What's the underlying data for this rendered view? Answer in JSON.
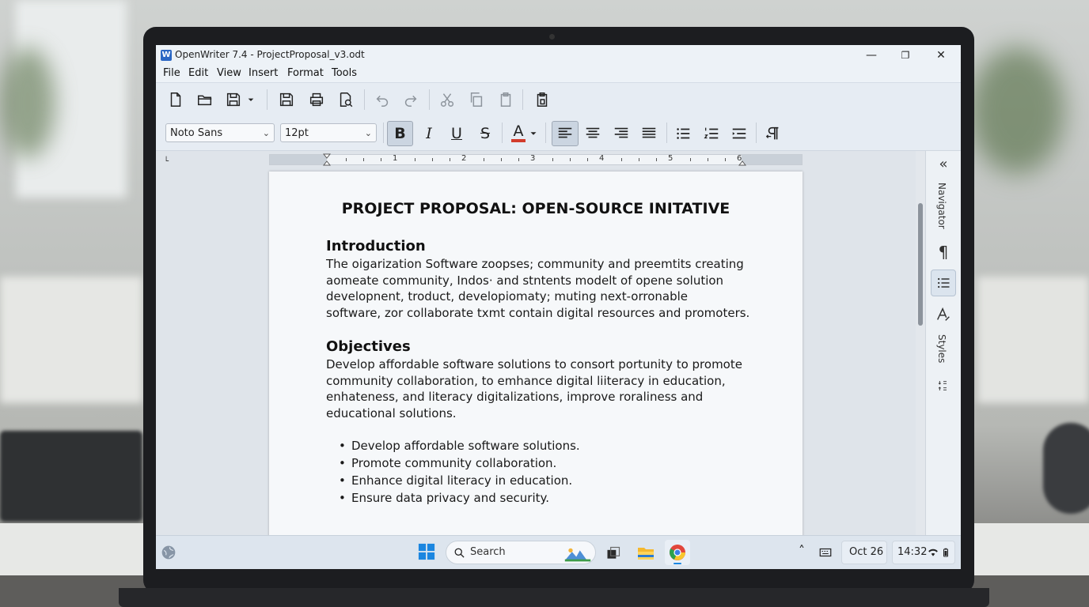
{
  "window": {
    "app_icon_letter": "W",
    "title": "OpenWriter 7.4 - ProjectProposal_v3.odt",
    "minimize": "—",
    "restore": "❐",
    "close": "✕"
  },
  "menu": [
    "File",
    "Edit",
    "View",
    "Insert",
    "Format",
    "Tools"
  ],
  "format_bar": {
    "font_name": "Noto Sans",
    "font_size": "12pt",
    "bold": "B",
    "italic": "I",
    "underline": "U",
    "strike": "S",
    "font_color_letter": "A",
    "font_color": "#d23b2b"
  },
  "ruler": {
    "corner": "└",
    "numbers": [
      "1",
      "2",
      "3",
      "4",
      "5",
      "6"
    ]
  },
  "document": {
    "title": "PROJECT PROPOSAL: OPEN-SOURCE INITATIVE",
    "intro_heading": "Introduction",
    "intro_lines": [
      "The oigarization Software zoopses; community and preemtits creating",
      "aomeate community, Indos· and stntents modelt of opene solution",
      "developnent, troduct, developiomaty; muting next-orronable",
      "software, zor collaborate txmt contain digital resources and promoters."
    ],
    "objectives_heading": "Objectives",
    "objectives_lines": [
      "Develop affordable software solutions to consort portunity to promote",
      "community collaboration, to emhance digital liiteracy in education,",
      "enhateness, and literacy digitalizations, improve roraliness and",
      "educational solutions."
    ],
    "bullets": [
      "Develop affordable software solutions.",
      "Promote community collaboration.",
      "Enhance digital literacy in education.",
      "Ensure data privacy and security."
    ]
  },
  "sidebar": {
    "collapse": "«",
    "navigator_label": "Navigator",
    "paragraph_icon": "¶",
    "styles_label": "Styles"
  },
  "taskbar": {
    "search_placeholder": "Search",
    "date": "Oct 26",
    "time": "14:32",
    "chevron": "˄"
  },
  "colors": {
    "accent": "#2b67c4",
    "toolbar_bg": "#e6ecf3",
    "page_bg": "#f6f8fa"
  }
}
